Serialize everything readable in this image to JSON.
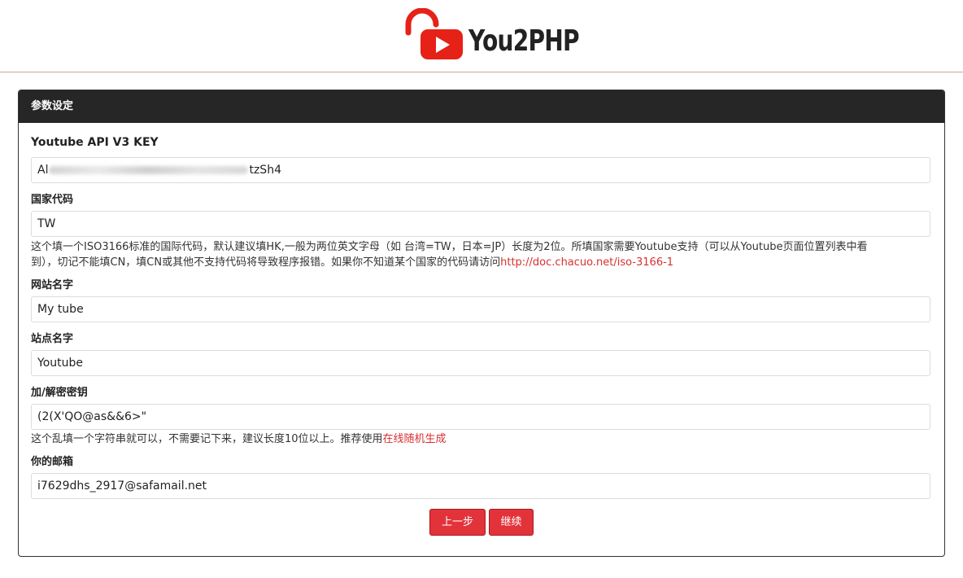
{
  "brand": {
    "logo_text": "You2PHP"
  },
  "panel": {
    "title": "参数设定"
  },
  "fields": {
    "api_key": {
      "label": "Youtube API V3 KEY",
      "value_start": "Al",
      "value_end": "tzSh4"
    },
    "country": {
      "label": "国家代码",
      "value": "TW",
      "help_line1": "这个填一个ISO3166标准的国际代码，默认建议填HK,一般为两位英文字母（如 台湾=TW，日本=JP）长度为2位。所填国家需要Youtube支持（可以从Youtube页面位置列表中看",
      "help_line2": "到），切记不能填CN，填CN或其他不支持代码将导致程序报错。如果你不知道某个国家的代码请访问",
      "help_link": "http://doc.chacuo.net/iso-3166-1"
    },
    "site_name": {
      "label": "网站名字",
      "value": "My tube"
    },
    "station_name": {
      "label": "站点名字",
      "value": "Youtube"
    },
    "secret": {
      "label": "加/解密密钥",
      "value": "(2(X'QO@as&&6>\"",
      "help_text": "这个乱填一个字符串就可以，不需要记下来，建议长度10位以上。推荐使用",
      "help_link": "在线随机生成"
    },
    "email": {
      "label": "你的邮箱",
      "value": "i7629dhs_2917@safamail.net"
    }
  },
  "buttons": {
    "prev": "上一步",
    "next": "继续"
  },
  "colors": {
    "accent": "#e3333a",
    "panel_header": "#262626",
    "link": "#d93030"
  }
}
